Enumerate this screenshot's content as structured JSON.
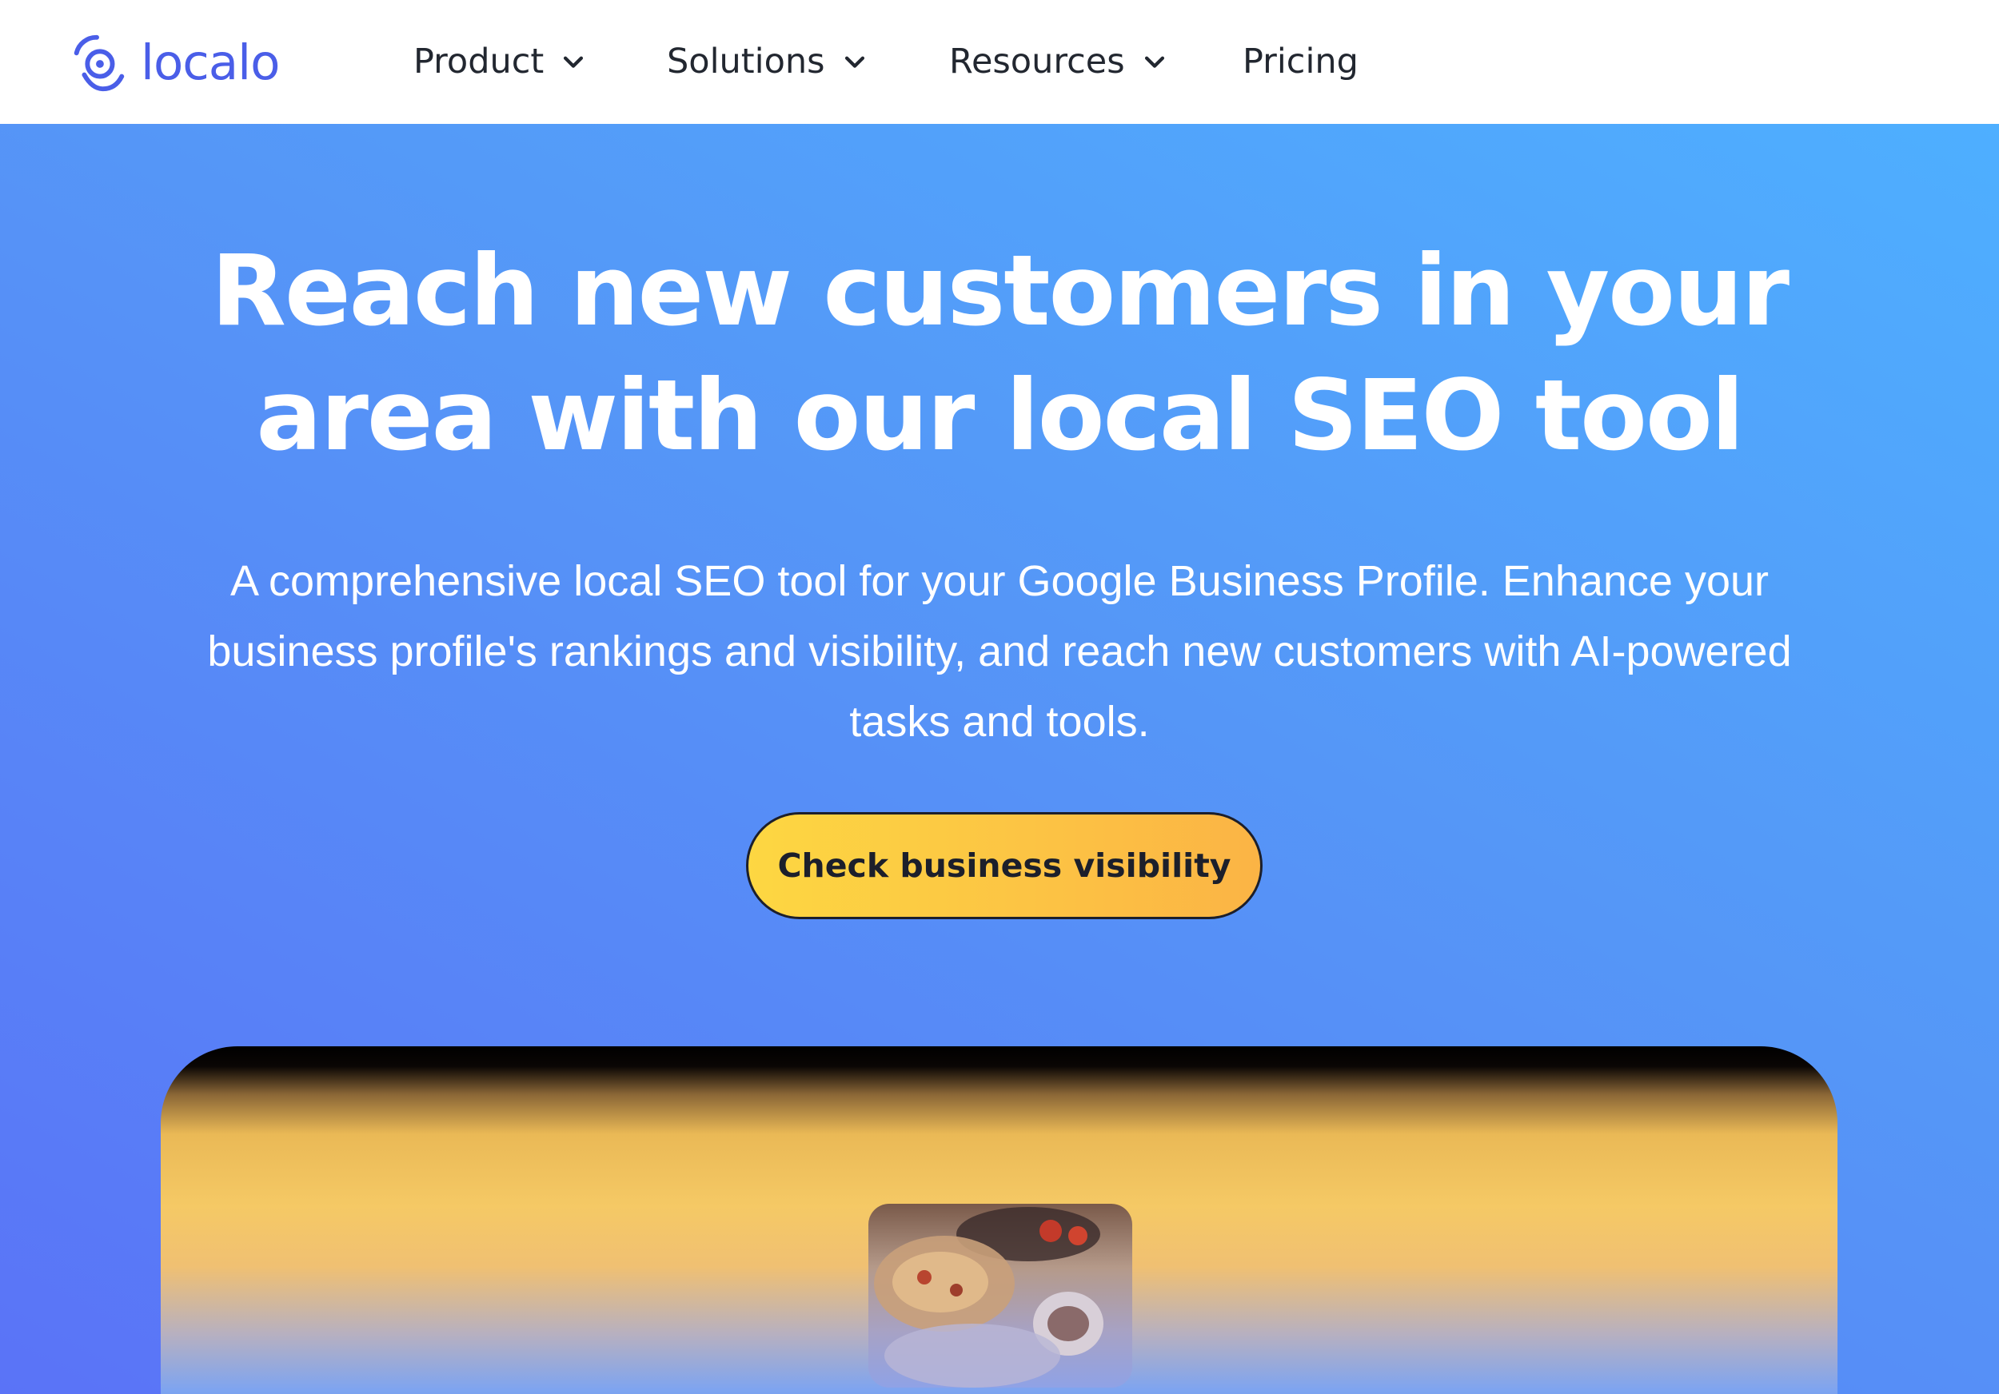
{
  "brand": {
    "name": "localo",
    "logo_icon": "location-pin-signal-icon",
    "color": "#4a5ee8"
  },
  "nav": {
    "items": [
      {
        "label": "Product",
        "has_dropdown": true
      },
      {
        "label": "Solutions",
        "has_dropdown": true
      },
      {
        "label": "Resources",
        "has_dropdown": true
      },
      {
        "label": "Pricing",
        "has_dropdown": false
      }
    ],
    "dropdown_icon": "chevron-down-icon"
  },
  "hero": {
    "title_line1": "Reach new customers in your",
    "title_line2": "area with our local SEO tool",
    "subtitle_line1": "A comprehensive local SEO tool for your Google Business Profile. Enhance your",
    "subtitle_line2": "business profile's rankings and visibility, and reach new customers with AI-powered",
    "subtitle_line3": "tasks and tools.",
    "cta_label": "Check business visibility"
  },
  "colors": {
    "hero_gradient_start": "#4eafff",
    "hero_gradient_end": "#5a73f7",
    "cta_start": "#fdd742",
    "cta_end": "#fbb445",
    "nav_text": "#222730"
  }
}
